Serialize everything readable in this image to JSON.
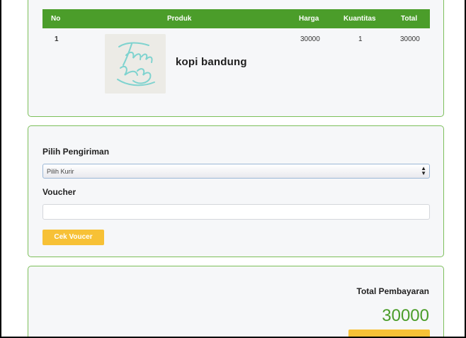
{
  "table": {
    "headers": {
      "no": "No",
      "product": "Produk",
      "price": "Harga",
      "quantity": "Kuantitas",
      "total": "Total"
    },
    "rows": [
      {
        "no": "1",
        "product": "kopi bandung",
        "price": "30000",
        "quantity": "1",
        "total": "30000"
      }
    ]
  },
  "shipping": {
    "label": "Pilih Pengiriman",
    "select_value": "Pilih Kurir",
    "voucher_label": "Voucher",
    "voucher_value": "",
    "voucher_button": "Cek Voucer"
  },
  "summary": {
    "label": "Total Pembayaran",
    "value": "30000"
  },
  "colors": {
    "accent": "#4b9d2a",
    "button": "#f7c136",
    "border": "#7cbf5a"
  }
}
